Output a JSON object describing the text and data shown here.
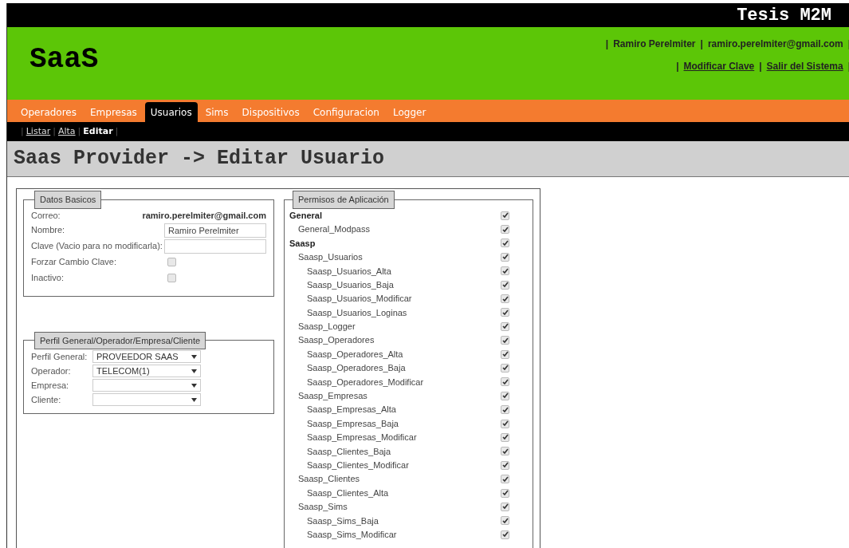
{
  "top_bar": {
    "title": "Tesis M2M"
  },
  "header": {
    "logo": "SaaS",
    "user_line": [
      {
        "kind": "sep",
        "text": "|"
      },
      {
        "kind": "text",
        "text": "Ramiro Perelmiter"
      },
      {
        "kind": "sep",
        "text": "|"
      },
      {
        "kind": "text",
        "text": "ramiro.perelmiter@gmail.com"
      },
      {
        "kind": "sep",
        "text": "|"
      }
    ],
    "links_line": [
      {
        "kind": "sep",
        "text": "|"
      },
      {
        "kind": "link",
        "text": "Modificar Clave"
      },
      {
        "kind": "sep",
        "text": "|"
      },
      {
        "kind": "link",
        "text": "Salir del Sistema"
      },
      {
        "kind": "sep",
        "text": "|"
      }
    ]
  },
  "nav_tabs": [
    {
      "label": "Operadores",
      "selected": false
    },
    {
      "label": "Empresas",
      "selected": false
    },
    {
      "label": "Usuarios",
      "selected": true
    },
    {
      "label": "Sims",
      "selected": false
    },
    {
      "label": "Dispositivos",
      "selected": false
    },
    {
      "label": "Configuracion",
      "selected": false
    },
    {
      "label": "Logger",
      "selected": false
    }
  ],
  "sub_nav": [
    {
      "kind": "sep",
      "label": "|"
    },
    {
      "kind": "link",
      "label": "Listar",
      "selected": false
    },
    {
      "kind": "sep",
      "label": "|"
    },
    {
      "kind": "link",
      "label": "Alta",
      "selected": false
    },
    {
      "kind": "sep",
      "label": "|"
    },
    {
      "kind": "link",
      "label": "Editar",
      "selected": true
    },
    {
      "kind": "sep",
      "label": "|"
    }
  ],
  "page_title": "Saas Provider -> Editar Usuario",
  "datos_basicos": {
    "legend": "Datos Basicos",
    "fields": [
      {
        "kind": "static",
        "label": "Correo:",
        "value": "ramiro.perelmiter@gmail.com"
      },
      {
        "kind": "input",
        "label": "Nombre:",
        "value": "Ramiro Perelmiter"
      },
      {
        "kind": "input",
        "label": "Clave (Vacio para no modificarla):"
      },
      {
        "kind": "checkbox",
        "label": "Forzar Cambio Clave:",
        "checked": false
      },
      {
        "kind": "checkbox",
        "label": "Inactivo:",
        "checked": false
      }
    ]
  },
  "perfil": {
    "legend": "Perfil General/Operador/Empresa/Cliente",
    "fields": [
      {
        "label": "Perfil General:",
        "value": "PROVEEDOR SAAS"
      },
      {
        "label": "Operador:",
        "value": "TELECOM(1)"
      },
      {
        "label": "Empresa:"
      },
      {
        "label": "Cliente:"
      }
    ]
  },
  "permisos": {
    "legend": "Permisos de Aplicación",
    "tree": [
      {
        "label": "General",
        "checked": true,
        "children": [
          {
            "label": "General_Modpass",
            "checked": true
          }
        ]
      },
      {
        "label": "Saasp",
        "checked": true,
        "children": [
          {
            "label": "Saasp_Usuarios",
            "checked": true,
            "children": [
              {
                "label": "Saasp_Usuarios_Alta",
                "checked": true
              },
              {
                "label": "Saasp_Usuarios_Baja",
                "checked": true
              },
              {
                "label": "Saasp_Usuarios_Modificar",
                "checked": true
              },
              {
                "label": "Saasp_Usuarios_Loginas",
                "checked": true
              }
            ]
          },
          {
            "label": "Saasp_Logger",
            "checked": true
          },
          {
            "label": "Saasp_Operadores",
            "checked": true,
            "children": [
              {
                "label": "Saasp_Operadores_Alta",
                "checked": true
              },
              {
                "label": "Saasp_Operadores_Baja",
                "checked": true
              },
              {
                "label": "Saasp_Operadores_Modificar",
                "checked": true
              }
            ]
          },
          {
            "label": "Saasp_Empresas",
            "checked": true,
            "children": [
              {
                "label": "Saasp_Empresas_Alta",
                "checked": true
              },
              {
                "label": "Saasp_Empresas_Baja",
                "checked": true
              },
              {
                "label": "Saasp_Empresas_Modificar",
                "checked": true
              },
              {
                "label": "Saasp_Clientes_Baja",
                "checked": true
              },
              {
                "label": "Saasp_Clientes_Modificar",
                "checked": true
              }
            ]
          },
          {
            "label": "Saasp_Clientes",
            "checked": true,
            "children": [
              {
                "label": "Saasp_Clientes_Alta",
                "checked": true
              }
            ]
          },
          {
            "label": "Saasp_Sims",
            "checked": true,
            "children": [
              {
                "label": "Saasp_Sims_Baja",
                "checked": true
              },
              {
                "label": "Saasp_Sims_Modificar",
                "checked": true
              }
            ]
          }
        ]
      }
    ]
  }
}
